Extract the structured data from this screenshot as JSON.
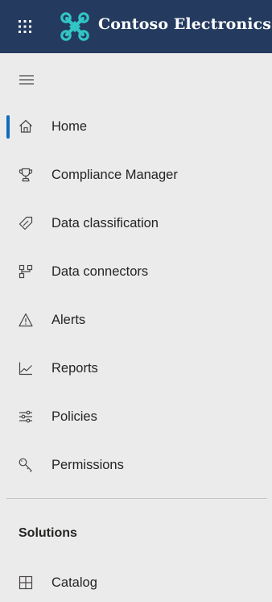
{
  "header": {
    "brand_name": "Contoso Electronics",
    "background": "#243a5e",
    "logo_color": "#31c5c4"
  },
  "sidebar": {
    "active_color": "#0f6cbd",
    "items": [
      {
        "label": "Home",
        "icon": "home-icon",
        "active": true
      },
      {
        "label": "Compliance Manager",
        "icon": "trophy-icon",
        "active": false
      },
      {
        "label": "Data classification",
        "icon": "tag-icon",
        "active": false
      },
      {
        "label": "Data connectors",
        "icon": "connector-icon",
        "active": false
      },
      {
        "label": "Alerts",
        "icon": "warning-icon",
        "active": false
      },
      {
        "label": "Reports",
        "icon": "chart-line-icon",
        "active": false
      },
      {
        "label": "Policies",
        "icon": "sliders-icon",
        "active": false
      },
      {
        "label": "Permissions",
        "icon": "key-icon",
        "active": false
      }
    ],
    "solutions": {
      "title": "Solutions",
      "items": [
        {
          "label": "Catalog",
          "icon": "catalog-icon",
          "active": false
        }
      ]
    }
  }
}
